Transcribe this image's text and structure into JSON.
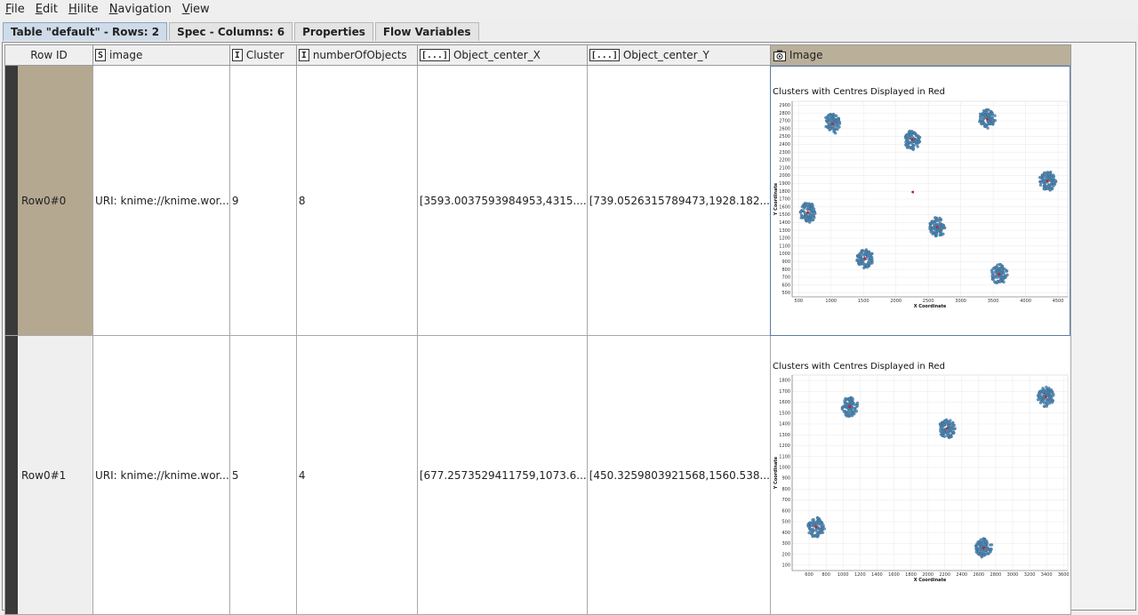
{
  "menu": [
    "File",
    "Edit",
    "Hilite",
    "Navigation",
    "View"
  ],
  "menu_mnemonics": [
    "F",
    "E",
    "H",
    "N",
    "V"
  ],
  "tabs": [
    {
      "label": "Table \"default\" - Rows: 2",
      "active": true
    },
    {
      "label": "Spec - Columns: 6",
      "active": false
    },
    {
      "label": "Properties",
      "active": false
    },
    {
      "label": "Flow Variables",
      "active": false
    }
  ],
  "table": {
    "row_id_header": "Row ID",
    "columns": [
      {
        "name": "image",
        "type_badge": "S"
      },
      {
        "name": "Cluster",
        "type_badge": "I"
      },
      {
        "name": "numberOfObjects",
        "type_badge": "I"
      },
      {
        "name": "Object_center_X",
        "type_badge": "[...]"
      },
      {
        "name": "Object_center_Y",
        "type_badge": "[...]"
      },
      {
        "name": "Image",
        "type_badge": "image-column-icon"
      }
    ],
    "rows": [
      {
        "row_id": "Row0#0",
        "image": "URI: knime://knime.wor...",
        "cluster": "9",
        "number_of_objects": "8",
        "object_center_x": "[3593.0037593984953,4315....",
        "object_center_y": "[739.0526315789473,1928.182..."
      },
      {
        "row_id": "Row0#1",
        "image": "URI: knime://knime.wor...",
        "cluster": "5",
        "number_of_objects": "4",
        "object_center_x": "[677.2573529411759,1073.6...",
        "object_center_y": "[450.3259803921568,1560.538..."
      }
    ]
  },
  "chart_data": [
    {
      "type": "scatter",
      "title": "Clusters with Centres Displayed in Red",
      "xlabel": "X Coordinate",
      "ylabel": "Y Coordinate",
      "xlim": [
        400,
        4650
      ],
      "ylim": [
        450,
        2950
      ],
      "x_ticks": [
        500,
        1000,
        1500,
        2000,
        2500,
        3000,
        3500,
        4000,
        4500
      ],
      "y_ticks": [
        500,
        600,
        700,
        800,
        900,
        1000,
        1100,
        1200,
        1300,
        1400,
        1500,
        1600,
        1700,
        1800,
        1900,
        2000,
        2100,
        2200,
        2300,
        2400,
        2500,
        2600,
        2700,
        2800,
        2900
      ],
      "grid": true,
      "point_color": "#4f86b0",
      "centre_color": "#d01c1c",
      "clusters": [
        {
          "x": 1020,
          "y": 2660
        },
        {
          "x": 3410,
          "y": 2720
        },
        {
          "x": 2250,
          "y": 2460
        },
        {
          "x": 4340,
          "y": 1930
        },
        {
          "x": 640,
          "y": 1530
        },
        {
          "x": 2640,
          "y": 1340
        },
        {
          "x": 1520,
          "y": 940
        },
        {
          "x": 3590,
          "y": 740
        }
      ],
      "centres": [
        {
          "x": 1020,
          "y": 2660
        },
        {
          "x": 3410,
          "y": 2720
        },
        {
          "x": 2250,
          "y": 2460
        },
        {
          "x": 4340,
          "y": 1930
        },
        {
          "x": 640,
          "y": 1530
        },
        {
          "x": 2640,
          "y": 1340
        },
        {
          "x": 1520,
          "y": 940
        },
        {
          "x": 3590,
          "y": 740
        },
        {
          "x": 2260,
          "y": 1790
        }
      ]
    },
    {
      "type": "scatter",
      "title": "Clusters with Centres Displayed in Red",
      "xlabel": "X Coordinate",
      "ylabel": "Y Coordinate",
      "xlim": [
        400,
        3650
      ],
      "ylim": [
        50,
        1850
      ],
      "x_ticks": [
        600,
        800,
        1000,
        1200,
        1400,
        1600,
        1800,
        2000,
        2200,
        2400,
        2600,
        2800,
        3000,
        3200,
        3400,
        3600
      ],
      "y_ticks": [
        100,
        200,
        300,
        400,
        500,
        600,
        700,
        800,
        900,
        1000,
        1100,
        1200,
        1300,
        1400,
        1500,
        1600,
        1700,
        1800
      ],
      "grid": true,
      "point_color": "#4f86b0",
      "centre_color": "#d01c1c",
      "clusters": [
        {
          "x": 1080,
          "y": 1560
        },
        {
          "x": 3390,
          "y": 1650
        },
        {
          "x": 2230,
          "y": 1360
        },
        {
          "x": 680,
          "y": 450
        },
        {
          "x": 2660,
          "y": 260
        }
      ],
      "centres": [
        {
          "x": 1080,
          "y": 1560
        },
        {
          "x": 3390,
          "y": 1650
        },
        {
          "x": 2230,
          "y": 1360
        },
        {
          "x": 680,
          "y": 450
        },
        {
          "x": 2660,
          "y": 260
        }
      ]
    }
  ]
}
